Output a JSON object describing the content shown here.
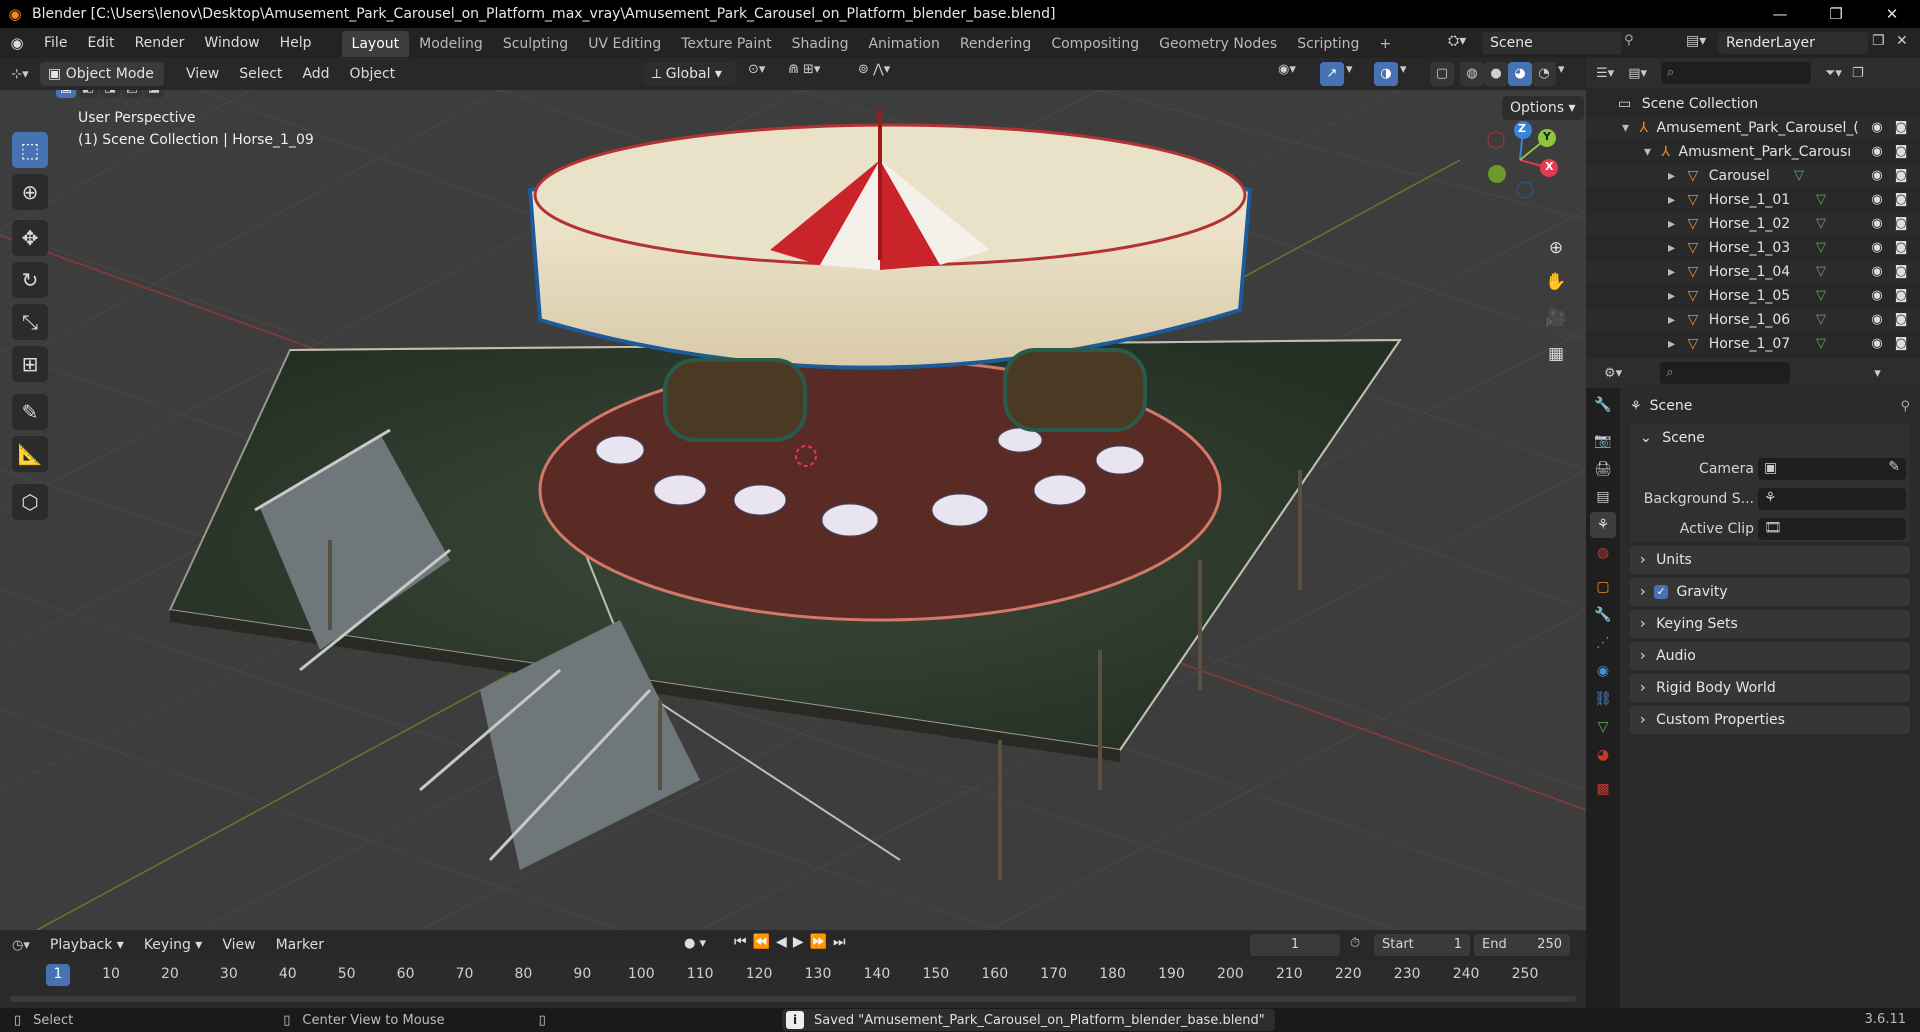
{
  "window": {
    "title": "Blender [C:\\Users\\lenov\\Desktop\\Amusement_Park_Carousel_on_Platform_max_vray\\Amusement_Park_Carousel_on_Platform_blender_base.blend]",
    "minimize": "—",
    "maximize": "❐",
    "close": "✕"
  },
  "menu": [
    "File",
    "Edit",
    "Render",
    "Window",
    "Help"
  ],
  "workspaces": [
    "Layout",
    "Modeling",
    "Sculpting",
    "UV Editing",
    "Texture Paint",
    "Shading",
    "Animation",
    "Rendering",
    "Compositing",
    "Geometry Nodes",
    "Scripting"
  ],
  "workspace_add": "+",
  "scene_name": "Scene",
  "view_layer": "RenderLayer",
  "viewport_header": {
    "mode": "Object Mode",
    "menus": [
      "View",
      "Select",
      "Add",
      "Object"
    ],
    "orientation": "Global",
    "options": "Options"
  },
  "viewport": {
    "perspective": "User Perspective",
    "collection_info": "(1) Scene Collection | Horse_1_09",
    "gizmo_labels": {
      "z": "Z",
      "y": "Y",
      "x": "X"
    }
  },
  "outliner": {
    "root": "Scene Collection",
    "items": [
      {
        "name": "Amusement_Park_Carousel_(",
        "depth": 1
      },
      {
        "name": "Amusment_Park_Carousı",
        "depth": 2
      },
      {
        "name": "Carousel",
        "depth": 3
      },
      {
        "name": "Horse_1_01",
        "depth": 3
      },
      {
        "name": "Horse_1_02",
        "depth": 3
      },
      {
        "name": "Horse_1_03",
        "depth": 3
      },
      {
        "name": "Horse_1_04",
        "depth": 3
      },
      {
        "name": "Horse_1_05",
        "depth": 3
      },
      {
        "name": "Horse_1_06",
        "depth": 3
      },
      {
        "name": "Horse_1_07",
        "depth": 3
      }
    ]
  },
  "properties": {
    "context": "Scene",
    "panel": "Scene",
    "fields": [
      {
        "label": "Camera"
      },
      {
        "label": "Background S..."
      },
      {
        "label": "Active Clip"
      }
    ],
    "subpanels": [
      "Units",
      "Gravity",
      "Keying Sets",
      "Audio",
      "Rigid Body World",
      "Custom Properties"
    ],
    "gravity_checked": true
  },
  "timeline": {
    "menus": [
      "Playback",
      "Keying",
      "View",
      "Marker"
    ],
    "current_frame": "1",
    "start_label": "Start",
    "start": "1",
    "end_label": "End",
    "end": "250",
    "ticks": [
      "1",
      "10",
      "20",
      "30",
      "40",
      "50",
      "60",
      "70",
      "80",
      "90",
      "100",
      "110",
      "120",
      "130",
      "140",
      "150",
      "160",
      "170",
      "180",
      "190",
      "200",
      "210",
      "220",
      "230",
      "240",
      "250"
    ]
  },
  "statusbar": {
    "select": "Select",
    "center_view": "Center View to Mouse",
    "message": "Saved \"Amusement_Park_Carousel_on_Platform_blender_base.blend\"",
    "version": "3.6.11"
  },
  "colors": {
    "accent": "#4772b3",
    "blender_orange": "#f08a24",
    "axis_x": "#e8384f",
    "axis_y": "#8cc63f",
    "axis_z": "#3b83d6"
  }
}
